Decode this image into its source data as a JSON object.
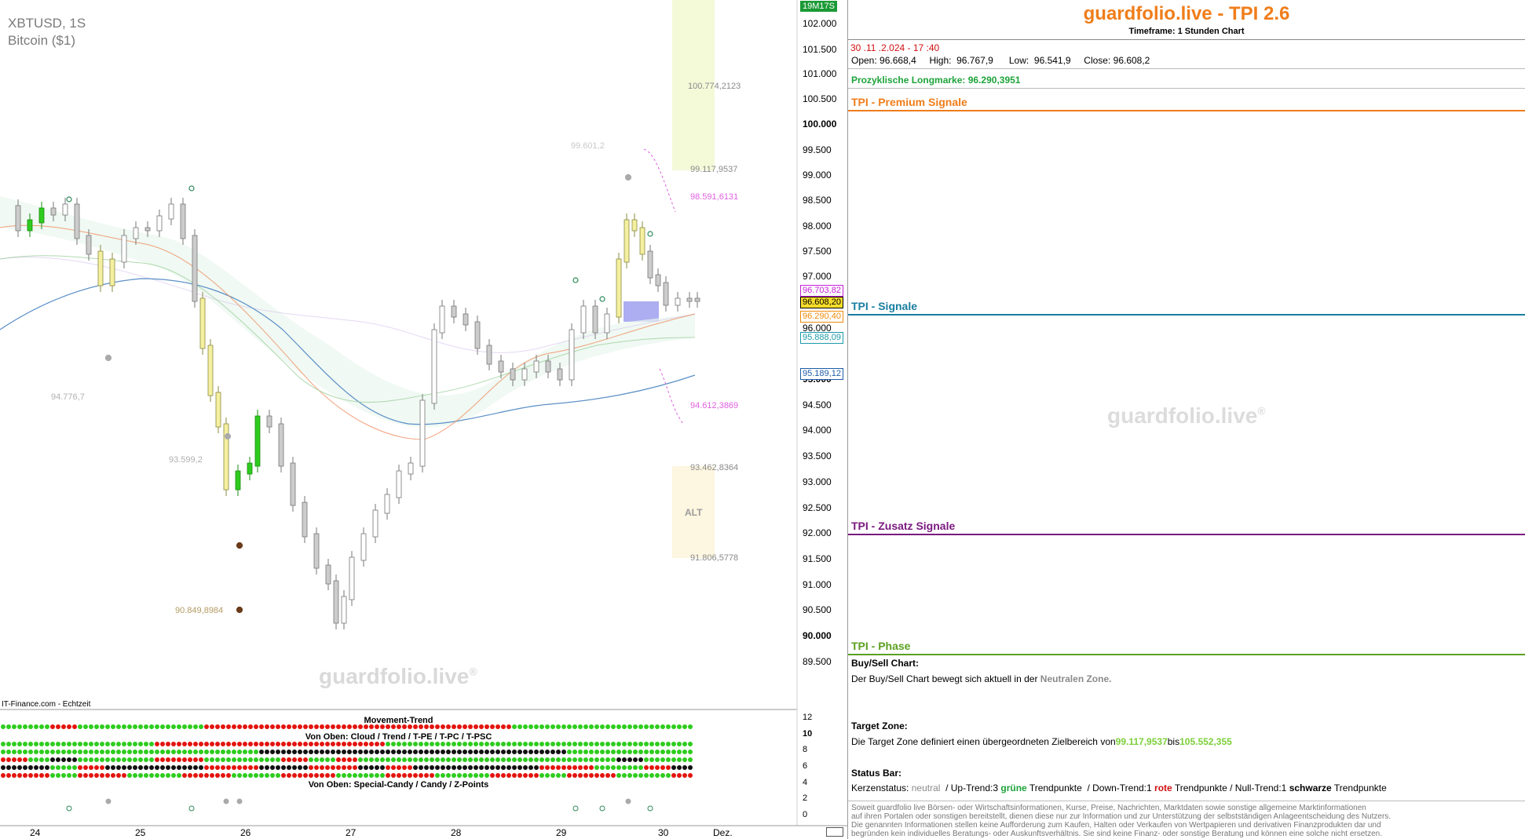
{
  "chart": {
    "symbol": "XBTUSD, 1S",
    "instrument": "Bitcoin ($1)",
    "timer": "19M17S",
    "source": "IT-Finance.com - Echtzeit",
    "watermark": "guardfolio.live",
    "registered": "®",
    "y_labels": [
      "102.000",
      "101.500",
      "101.000",
      "100.500",
      "100.000",
      "99.500",
      "99.000",
      "98.500",
      "98.000",
      "97.500",
      "97.000",
      "96.000",
      "95.000",
      "94.500",
      "94.000",
      "93.500",
      "93.000",
      "92.500",
      "92.000",
      "91.500",
      "91.000",
      "90.500",
      "90.000",
      "89.500"
    ],
    "x_labels": [
      "24",
      "25",
      "26",
      "27",
      "28",
      "29",
      "30",
      "Dez."
    ],
    "price_tags": {
      "t1": "96.703,82",
      "t2": "96.608,20",
      "t3": "96.290,40",
      "t4": "95.888,09",
      "t5": "95.189,12"
    },
    "annotations": {
      "a1": "100.774,2123",
      "a2": "99.117,9537",
      "a3": "98.591,6131",
      "a4": "99.601,2",
      "a5": "94.776,7",
      "a6": "93.599,2",
      "a7": "94.612,3869",
      "a8": "93.462,8364",
      "a9": "ALT",
      "a10": "91.806,5778",
      "a11": "90.849,8984"
    },
    "colors": {
      "green": "#2ecc1e",
      "red": "#e3140e",
      "black": "#111111",
      "gold": "#f5f0a0",
      "blue_ma": "#5a8fc7",
      "orange_ma": "#f08a5a"
    },
    "indicator": {
      "movement_title": "Movement-Trend",
      "top_title": "Von Oben: Cloud / Trend / T-PE / T-PC / T-PSC",
      "bottom_title": "Von Oben: Special-Candy / Candy / Z-Points",
      "y_labels": [
        "12",
        "10",
        "8",
        "6",
        "4",
        "2",
        "0"
      ]
    }
  },
  "panel": {
    "title": "guardfolio.live - TPI 2.6",
    "timeframe": "Timeframe: 1 Stunden Chart",
    "datetime": "30 .11 .2.024  - 17 :40",
    "ohlc": {
      "open_label": "Open:",
      "open": "96.668,4",
      "high_label": "High:",
      "high": "96.767,9",
      "low_label": "Low:",
      "low": "96.541,9",
      "close_label": "Close:",
      "close": "96.608,2"
    },
    "longmarke_label": "Prozyklische Longmarke:",
    "longmarke": "96.290,3951",
    "sections": {
      "premium": "TPI - Premium Signale",
      "signale": "TPI - Signale",
      "zusatz": "TPI - Zusatz Signale",
      "phase": "TPI - Phase"
    },
    "watermark": "guardfolio.live",
    "buysell": {
      "title": "Buy/Sell Chart:",
      "text": "Der Buy/Sell Chart bewegt sich aktuell in der",
      "zone": "Neutralen Zone."
    },
    "target": {
      "title": "Target Zone:",
      "text": "Die Target Zone definiert einen übergeordneten Zielbereich von",
      "from": "99.117,9537",
      "mid": "bis",
      "to": "105.552,355"
    },
    "status": {
      "title": "Status Bar:",
      "k_label": "Kerzenstatus:",
      "k_value": "neutral",
      "up": "/ Up-Trend:3",
      "green_word": "grüne",
      "tp1": "Trendpunkte",
      "down": "/ Down-Trend:1",
      "red_word": "rote",
      "tp2": "Trendpunkte / Null-Trend:1",
      "black_word": "schwarze",
      "tp3": "Trendpunkte"
    },
    "disclaimer": [
      "Soweit guardfolio live Börsen- oder Wirtschaftsinformationen, Kurse, Preise, Nachrichten, Marktdaten sowie sonstige allgemeine Marktinformationen",
      "auf ihren Portalen oder sonstigen bereitstellt, dienen diese nur zur Information und zur Unterstützung der selbstständigen Anlageentscheidung des Nutzers.",
      "Die genannten Informationen stellen keine Aufforderung zum Kaufen, Halten oder Verkaufen von Wertpapieren und derivativen Finanzprodukten dar und",
      "begründen kein individuelles Beratungs- oder Auskunftsverhältnis. Sie sind keine Finanz- oder sonstige Beratung und können eine solche nicht ersetzen."
    ]
  }
}
